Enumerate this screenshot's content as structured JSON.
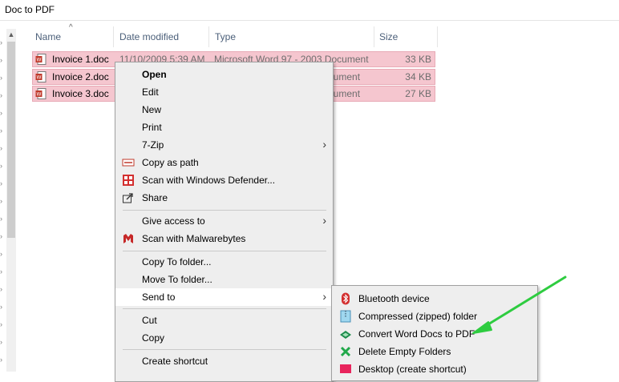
{
  "window": {
    "title": "Doc to PDF"
  },
  "columns": {
    "name": "Name",
    "date": "Date modified",
    "type": "Type",
    "size": "Size"
  },
  "files": [
    {
      "name": "Invoice 1.doc",
      "date": "11/10/2009 5:39 AM",
      "type": "Microsoft Word 97 - 2003 Document",
      "size": "33 KB"
    },
    {
      "name": "Invoice 2.doc",
      "date": "",
      "type": "ocument",
      "size": "34 KB"
    },
    {
      "name": "Invoice 3.doc",
      "date": "",
      "type": "ocument",
      "size": "27 KB"
    }
  ],
  "context_menu": {
    "open": "Open",
    "edit": "Edit",
    "new": "New",
    "print": "Print",
    "zip": "7-Zip",
    "copy_path": "Copy as path",
    "defender": "Scan with Windows Defender...",
    "share": "Share",
    "give_access": "Give access to",
    "malwarebytes": "Scan with Malwarebytes",
    "copy_to": "Copy To folder...",
    "move_to": "Move To folder...",
    "send_to": "Send to",
    "cut": "Cut",
    "copy": "Copy",
    "create_shortcut": "Create shortcut"
  },
  "send_to_menu": {
    "bluetooth": "Bluetooth device",
    "compressed": "Compressed (zipped) folder",
    "convert": "Convert Word Docs to PDF",
    "delete_empty": "Delete Empty Folders",
    "desktop": "Desktop (create shortcut)"
  },
  "colors": {
    "selection": "#f5c6cf",
    "menu_bg": "#eeeeee",
    "highlight": "#ffffff",
    "arrow": "#2ecc40"
  },
  "icons": {
    "word_doc": "word-doc-icon",
    "copy_path": "copy-path-icon",
    "defender": "windows-defender-icon",
    "share": "share-icon",
    "malwarebytes": "malwarebytes-icon",
    "bluetooth": "bluetooth-icon",
    "zip": "zip-folder-icon",
    "convert": "convert-pdf-icon",
    "delete": "delete-x-icon",
    "desktop": "desktop-icon"
  }
}
